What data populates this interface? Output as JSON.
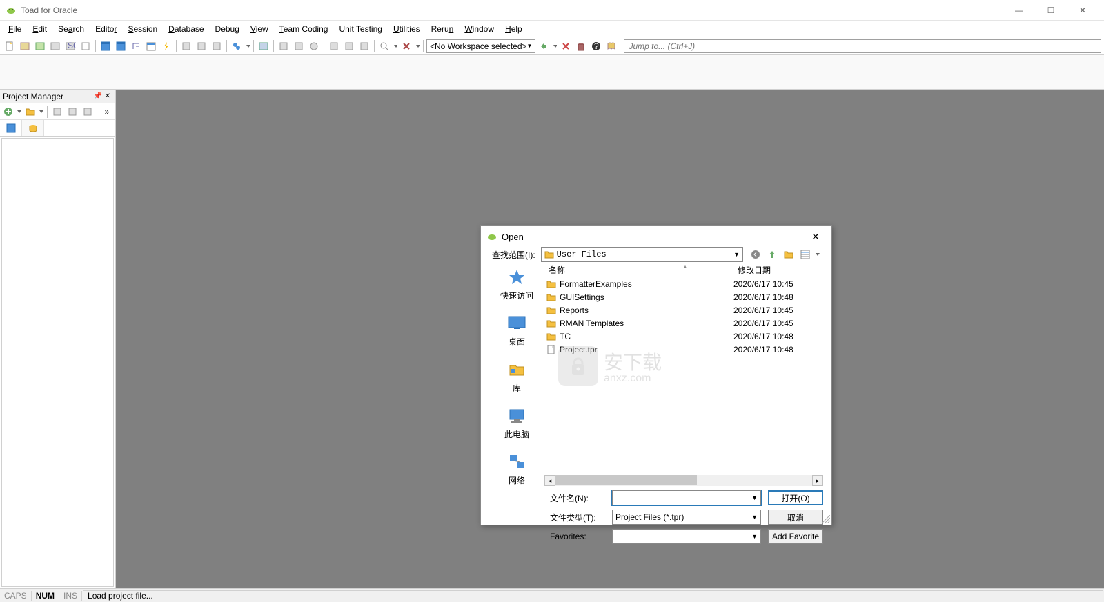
{
  "window": {
    "title": "Toad for Oracle",
    "min": "—",
    "max": "☐",
    "close": "✕"
  },
  "menu": [
    "File",
    "Edit",
    "Search",
    "Editor",
    "Session",
    "Database",
    "Debug",
    "View",
    "Team Coding",
    "Unit Testing",
    "Utilities",
    "Rerun",
    "Window",
    "Help"
  ],
  "toolbar": {
    "workspace_combo": "<No Workspace selected>",
    "jump_placeholder": "Jump to... (Ctrl+J)"
  },
  "project_panel": {
    "title": "Project Manager"
  },
  "dialog": {
    "title": "Open",
    "lookin_label": "查找范围(I):",
    "lookin_value": "User Files",
    "col_name": "名称",
    "col_date": "修改日期",
    "files": [
      {
        "name": "FormatterExamples",
        "date": "2020/6/17 10:45",
        "type": "folder"
      },
      {
        "name": "GUISettings",
        "date": "2020/6/17 10:48",
        "type": "folder"
      },
      {
        "name": "Reports",
        "date": "2020/6/17 10:45",
        "type": "folder"
      },
      {
        "name": "RMAN Templates",
        "date": "2020/6/17 10:45",
        "type": "folder"
      },
      {
        "name": "TC",
        "date": "2020/6/17 10:48",
        "type": "folder"
      },
      {
        "name": "Project.tpr",
        "date": "2020/6/17 10:48",
        "type": "file"
      }
    ],
    "places": [
      {
        "label": "快速访问",
        "icon": "star"
      },
      {
        "label": "桌面",
        "icon": "desktop"
      },
      {
        "label": "库",
        "icon": "library"
      },
      {
        "label": "此电脑",
        "icon": "computer"
      },
      {
        "label": "网络",
        "icon": "network"
      }
    ],
    "filename_label": "文件名(N):",
    "filename_value": "",
    "filetype_label": "文件类型(T):",
    "filetype_value": "Project Files (*.tpr)",
    "favorites_label": "Favorites:",
    "favorites_value": "",
    "open_btn": "打开(O)",
    "cancel_btn": "取消",
    "addfav_btn": "Add Favorite"
  },
  "watermark": {
    "main": "安下载",
    "sub": "anxz.com"
  },
  "status": {
    "caps": "CAPS",
    "num": "NUM",
    "ins": "INS",
    "msg": "Load project file..."
  }
}
